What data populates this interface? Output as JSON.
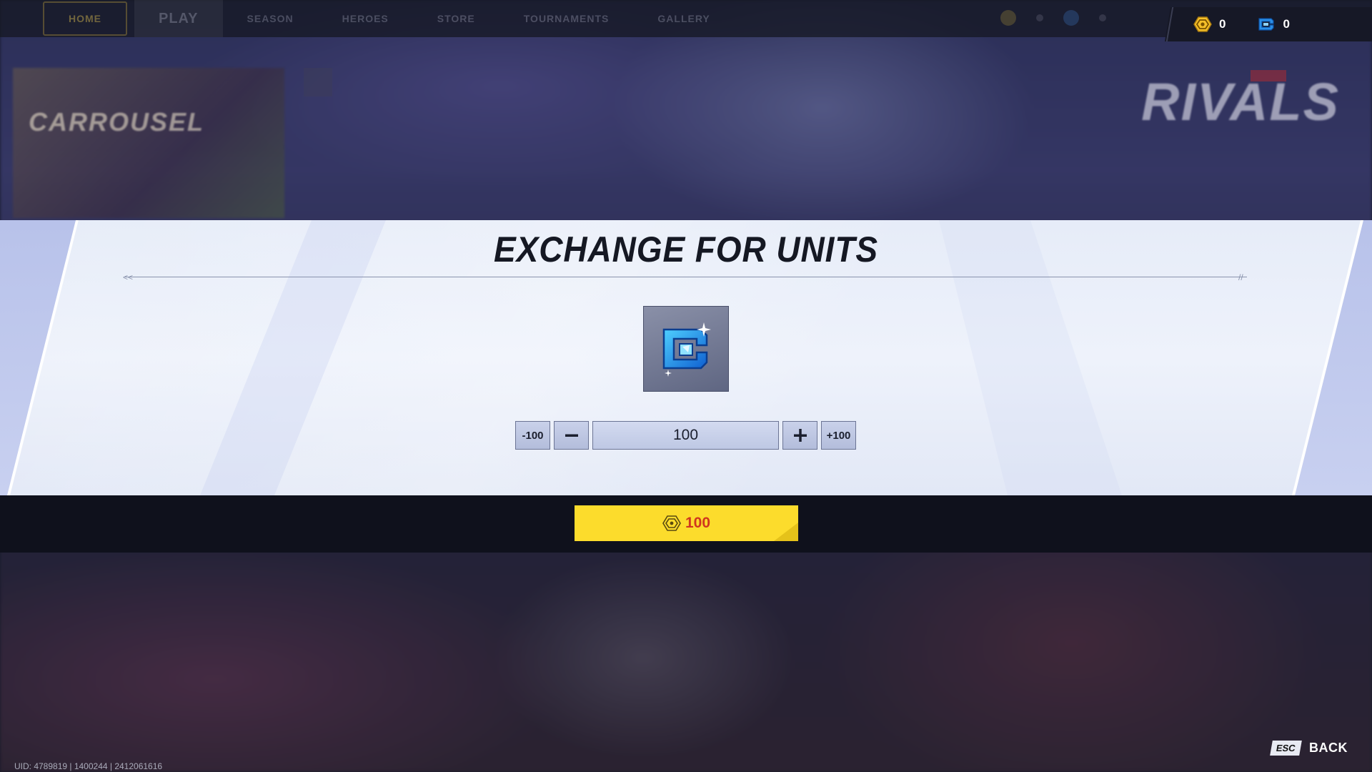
{
  "nav": {
    "items": [
      "Home",
      "Play",
      "Season",
      "Heroes",
      "Store",
      "Tournaments",
      "Gallery"
    ]
  },
  "currencies": [
    {
      "name": "lattice",
      "icon": "lattice-coin-icon",
      "amount": "0",
      "color": "#f5c02a"
    },
    {
      "name": "units",
      "icon": "units-chip-icon",
      "amount": "0",
      "color": "#2a8fe8"
    }
  ],
  "background": {
    "carousel_title": "CARROUSEL",
    "logo_text": "RIVALS"
  },
  "modal": {
    "title": "EXCHANGE FOR UNITS",
    "item_icon": "units-chip-icon",
    "stepper": {
      "minus_100_label": "-100",
      "minus_icon": "minus-icon",
      "value": "100",
      "plus_icon": "plus-icon",
      "plus_100_label": "+100"
    }
  },
  "confirm": {
    "icon": "lattice-coin-icon",
    "price": "100",
    "color": "#fcdc2c"
  },
  "footer": {
    "uid": "UID: 4789819 | 1400244 | 2412061616",
    "back_key": "ESC",
    "back_label": "BACK"
  }
}
